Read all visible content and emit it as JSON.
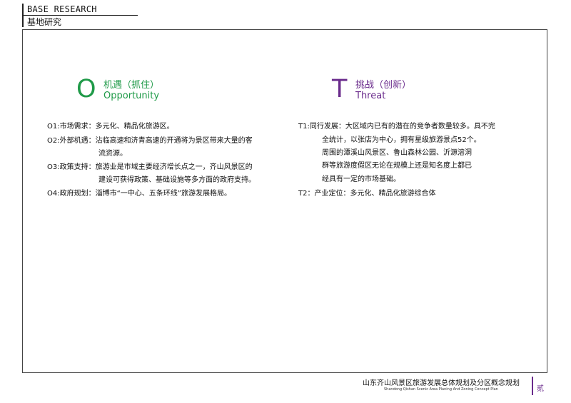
{
  "header": {
    "title_en": "BASE RESEARCH",
    "title_cn": "基地研究"
  },
  "opportunity": {
    "letter": "O",
    "title_cn": "机遇（抓住）",
    "title_en": "Opportunity",
    "color": "#1f9a48",
    "lines": [
      "O1:市场需求：多元化、精品化旅游区。",
      "O2:外部机遇：沾临高速和济青高速的开通将为景区带来大量的客",
      "流资源。",
      "O3:政策支持：旅游业是市域主要经济增长点之一，齐山风景区的",
      "建设可获得政策、基础设施等多方面的政府支持。",
      "O4:政府规划：淄博市“一中心、五条环线”旅游发展格局。"
    ]
  },
  "threat": {
    "letter": "T",
    "title_cn": "挑战（创新）",
    "title_en": "Threat",
    "color": "#6a2b8c",
    "lines": [
      "T1:同行发展：大区域内已有的潜在的竞争者数量较多。具不完",
      "全统计，以张店为中心，拥有星级旅游景点52个。",
      "周围的潭溪山风景区、鲁山森林公园、沂源溶洞",
      "群等旅游度假区无论在规模上还是知名度上都已",
      "经具有一定的市场基础。",
      "T2：产业定位：多元化、精品化旅游综合体"
    ]
  },
  "footer": {
    "title_cn": "山东齐山风景区旅游发展总体规划及分区概念规划",
    "title_en": "Shandong Qishan Scenic Area Planing And Zoning Concept Plan",
    "page_number": "贰"
  }
}
